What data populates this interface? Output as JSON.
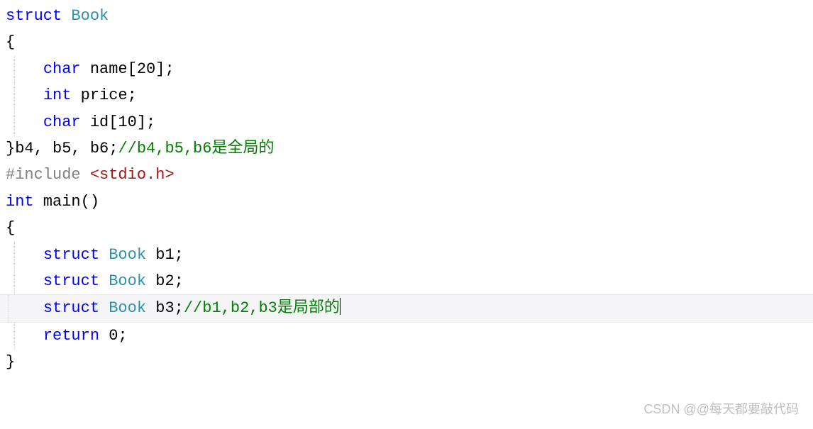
{
  "code": {
    "line1": {
      "struct": "struct",
      "book": " Book"
    },
    "line2": "{",
    "line3": {
      "indent": "    ",
      "char": "char",
      "name": " name[20];"
    },
    "line4": {
      "indent": "    ",
      "int": "int",
      "price": " price;"
    },
    "line5": {
      "indent": "    ",
      "char": "char",
      "id": " id[10];"
    },
    "line6": {
      "close": "}b4, b5, b6;",
      "comment": "//b4,b5,b6是全局的"
    },
    "line7": {
      "include": "#include",
      "header": " <stdio.h>"
    },
    "line8": {
      "int": "int",
      "main": " main()"
    },
    "line9": "{",
    "line10": {
      "indent": "    ",
      "struct": "struct",
      "book": " Book",
      "var": " b1;"
    },
    "line11": {
      "indent": "    ",
      "struct": "struct",
      "book": " Book",
      "var": " b2;"
    },
    "line12": {
      "indent": "    ",
      "struct": "struct",
      "book": " Book",
      "var": " b3;",
      "comment": "//b1,b2,b3是局部的"
    },
    "line13": "",
    "line14": {
      "indent": "    ",
      "return": "return",
      "zero": " 0;"
    },
    "line15": "}"
  },
  "watermark": "CSDN @@每天都要敲代码"
}
